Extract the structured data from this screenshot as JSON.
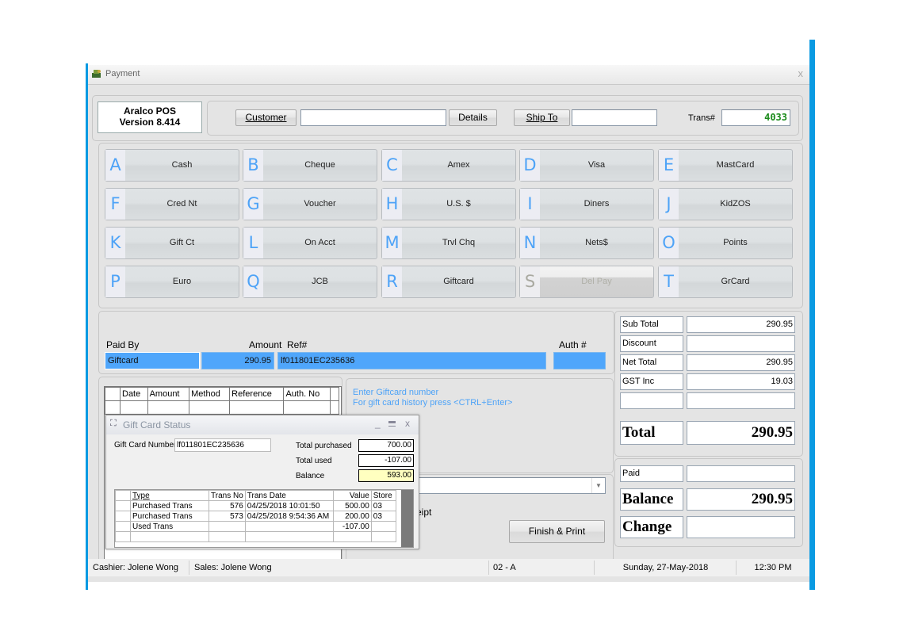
{
  "window": {
    "title": "Payment",
    "close_label": "x"
  },
  "header": {
    "version_line1": "Aralco POS",
    "version_line2": "Version 8.414",
    "customer_button": "Customer",
    "customer_value": "",
    "details_button": "Details",
    "ship_to_button": "Ship To",
    "ship_to_value": "",
    "trans_label": "Trans#",
    "trans_value": "4033"
  },
  "payment_methods": [
    {
      "key": "A",
      "label": "Cash",
      "enabled": true
    },
    {
      "key": "B",
      "label": "Cheque",
      "enabled": true
    },
    {
      "key": "C",
      "label": "Amex",
      "enabled": true
    },
    {
      "key": "D",
      "label": "Visa",
      "enabled": true
    },
    {
      "key": "E",
      "label": "MastCard",
      "enabled": true
    },
    {
      "key": "F",
      "label": "Cred Nt",
      "enabled": true
    },
    {
      "key": "G",
      "label": "Voucher",
      "enabled": true
    },
    {
      "key": "H",
      "label": "U.S. $",
      "enabled": true
    },
    {
      "key": "I",
      "label": "Diners",
      "enabled": true
    },
    {
      "key": "J",
      "label": "KidZOS",
      "enabled": true
    },
    {
      "key": "K",
      "label": "Gift Ct",
      "enabled": true
    },
    {
      "key": "L",
      "label": "On Acct",
      "enabled": true
    },
    {
      "key": "M",
      "label": "Trvl Chq",
      "enabled": true
    },
    {
      "key": "N",
      "label": "Nets$",
      "enabled": true
    },
    {
      "key": "O",
      "label": "Points",
      "enabled": true
    },
    {
      "key": "P",
      "label": "Euro",
      "enabled": true
    },
    {
      "key": "Q",
      "label": "JCB",
      "enabled": true
    },
    {
      "key": "R",
      "label": "Giftcard",
      "enabled": true
    },
    {
      "key": "S",
      "label": "Del Pay",
      "enabled": false
    },
    {
      "key": "T",
      "label": "GrCard",
      "enabled": true
    }
  ],
  "entry": {
    "paid_by_label": "Paid By",
    "amount_label": "Amount",
    "ref_label": "Ref#",
    "auth_label": "Auth #",
    "paid_by_value": "Giftcard",
    "amount_value": "290.95",
    "ref_value": "lf011801EC235636",
    "auth_value": ""
  },
  "payments_table": {
    "columns": [
      "Date",
      "Amount",
      "Method",
      "Reference",
      "Auth. No"
    ]
  },
  "hint": {
    "line1": "Enter Giftcard number",
    "line2": "For gift card history press <CTRL+Enter>"
  },
  "receipt": {
    "dropdown_value": "",
    "receipt_text": "eipt",
    "finish_button": "Finish & Print"
  },
  "totals": {
    "sub_total_label": "Sub Total",
    "sub_total": "290.95",
    "discount_label": "Discount",
    "discount": "",
    "net_total_label": "Net Total",
    "net_total": "290.95",
    "gst_label": "GST Inc",
    "gst": "19.03",
    "blank_label": "",
    "blank_value": "",
    "total_label": "Total",
    "total": "290.95"
  },
  "balance": {
    "paid_label": "Paid",
    "paid": "",
    "balance_label": "Balance",
    "balance": "290.95",
    "change_label": "Change",
    "change": ""
  },
  "gift_card_popup": {
    "title": "Gift Card Status",
    "card_number_label": "Gift Card Number",
    "card_number": "lf011801EC235636",
    "total_purchased_label": "Total purchased",
    "total_purchased": "700.00",
    "total_used_label": "Total used",
    "total_used": "-107.00",
    "balance_label": "Balance",
    "balance": "593.00",
    "columns": [
      "Type",
      "Trans No",
      "Trans Date",
      "Value",
      "Store"
    ],
    "rows": [
      {
        "type": "Purchased Trans",
        "trans_no": "576",
        "date": "04/25/2018 10:01:50",
        "value": "500.00",
        "store": "03"
      },
      {
        "type": "Purchased Trans",
        "trans_no": "573",
        "date": "04/25/2018 9:54:36 AM",
        "value": "200.00",
        "store": "03"
      },
      {
        "type": "Used Trans",
        "trans_no": "",
        "date": "",
        "value": "-107.00",
        "store": ""
      }
    ]
  },
  "status_bar": {
    "cashier": "Cashier: Jolene Wong",
    "sales": "Sales: Jolene Wong",
    "station": "02 - A",
    "date": "Sunday, 27-May-2018",
    "time": "12:30 PM"
  },
  "colors": {
    "accent": "#0a9ae2",
    "key_letter": "#4ea3f7",
    "selected_field": "#4fa6fb",
    "trans_number": "#1a8a1a",
    "balance_highlight": "#ffffc0"
  }
}
